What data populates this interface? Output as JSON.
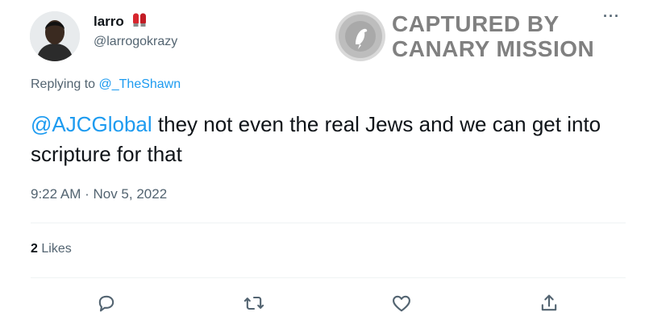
{
  "user": {
    "display_name": "larro",
    "handle": "@larrogokrazy",
    "name_emoji": "boxing-gloves-icon"
  },
  "watermark": {
    "line1": "CAPTURED BY",
    "line2": "CANARY MISSION",
    "icon": "canary-bird-icon"
  },
  "reply": {
    "prefix": "Replying to",
    "target": "@_TheShawn"
  },
  "tweet": {
    "mention": "@AJCGlobal",
    "text": " they not even the real Jews and we can get into scripture for that"
  },
  "timestamp": "9:22 AM · Nov 5, 2022",
  "stats": {
    "likes_count": "2",
    "likes_label": "Likes"
  },
  "actions": [
    {
      "name": "reply-button",
      "icon": "comment-icon"
    },
    {
      "name": "retweet-button",
      "icon": "retweet-icon"
    },
    {
      "name": "like-button",
      "icon": "heart-icon"
    },
    {
      "name": "share-button",
      "icon": "share-icon"
    }
  ],
  "more_label": "···",
  "colors": {
    "link": "#1d9bf0",
    "secondary_text": "#536471",
    "primary_text": "#0f1419",
    "watermark": "#808080"
  }
}
